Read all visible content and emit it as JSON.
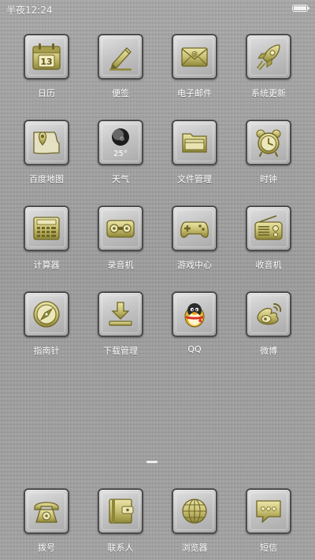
{
  "status_bar": {
    "time": "半夜12:24",
    "battery_level": 1.0
  },
  "colors": {
    "icon_gold": "#c8bf72",
    "icon_gold_dark": "#6e6626",
    "tile_border": "#4c4c4c"
  },
  "apps": [
    {
      "label": "日历",
      "icon": "calendar-icon",
      "date": "13"
    },
    {
      "label": "便签",
      "icon": "note-pencil-icon"
    },
    {
      "label": "电子邮件",
      "icon": "envelope-icon"
    },
    {
      "label": "系统更新",
      "icon": "rocket-icon"
    },
    {
      "label": "百度地图",
      "icon": "map-pin-icon"
    },
    {
      "label": "天气",
      "icon": "moon-weather-icon",
      "temperature": "25°"
    },
    {
      "label": "文件管理",
      "icon": "folder-icon"
    },
    {
      "label": "时钟",
      "icon": "alarm-clock-icon"
    },
    {
      "label": "计算器",
      "icon": "calculator-icon"
    },
    {
      "label": "录音机",
      "icon": "cassette-icon"
    },
    {
      "label": "游戏中心",
      "icon": "gamepad-icon"
    },
    {
      "label": "收音机",
      "icon": "radio-icon"
    },
    {
      "label": "指南针",
      "icon": "compass-icon"
    },
    {
      "label": "下载管理",
      "icon": "download-icon"
    },
    {
      "label": "QQ",
      "icon": "qq-penguin-icon"
    },
    {
      "label": "微博",
      "icon": "weibo-icon"
    }
  ],
  "dock": [
    {
      "label": "拨号",
      "icon": "telephone-icon"
    },
    {
      "label": "联系人",
      "icon": "contacts-book-icon"
    },
    {
      "label": "浏览器",
      "icon": "globe-icon"
    },
    {
      "label": "短信",
      "icon": "message-bubble-icon"
    }
  ],
  "page_indicator": {
    "current_page": 1
  }
}
